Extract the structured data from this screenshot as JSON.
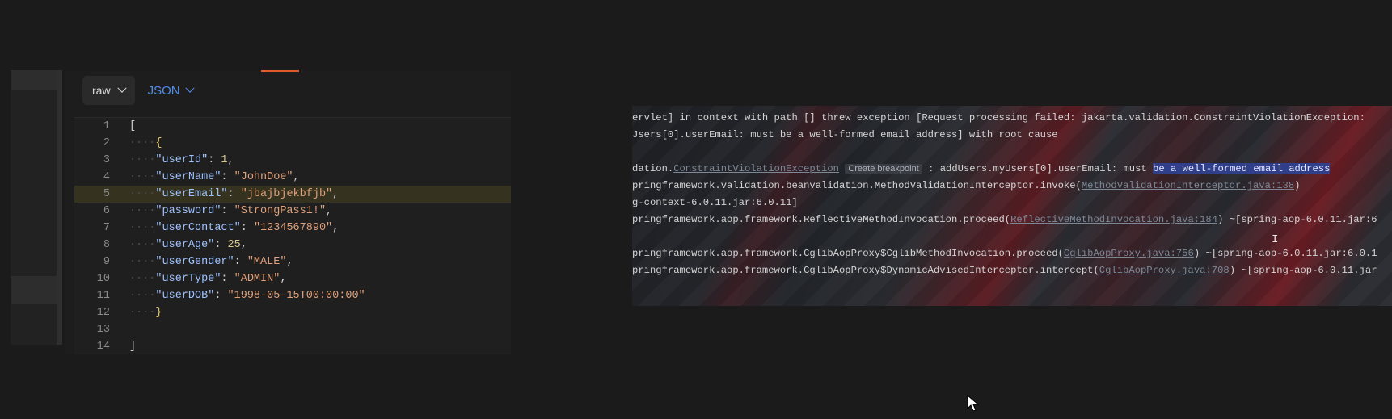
{
  "body_editor": {
    "format_dropdown": "raw",
    "type_dropdown": "JSON",
    "lines": [
      {
        "num": "1",
        "parts": [
          {
            "t": "p",
            "v": "["
          }
        ]
      },
      {
        "num": "2",
        "parts": [
          {
            "t": "d",
            "v": "····"
          },
          {
            "t": "b",
            "v": "{"
          }
        ]
      },
      {
        "num": "3",
        "parts": [
          {
            "t": "d",
            "v": "····"
          },
          {
            "t": "k",
            "v": "\"userId\""
          },
          {
            "t": "p",
            "v": ": "
          },
          {
            "t": "n",
            "v": "1"
          },
          {
            "t": "p",
            "v": ","
          }
        ]
      },
      {
        "num": "4",
        "parts": [
          {
            "t": "d",
            "v": "····"
          },
          {
            "t": "k",
            "v": "\"userName\""
          },
          {
            "t": "p",
            "v": ": "
          },
          {
            "t": "s",
            "v": "\"JohnDoe\""
          },
          {
            "t": "p",
            "v": ","
          }
        ]
      },
      {
        "num": "5",
        "highlight": true,
        "parts": [
          {
            "t": "d",
            "v": "····"
          },
          {
            "t": "k",
            "v": "\"userEmail\""
          },
          {
            "t": "p",
            "v": ": "
          },
          {
            "t": "s",
            "v": "\"jbajbjekbfjb\""
          },
          {
            "t": "p",
            "v": ","
          }
        ]
      },
      {
        "num": "6",
        "parts": [
          {
            "t": "d",
            "v": "····"
          },
          {
            "t": "k",
            "v": "\"password\""
          },
          {
            "t": "p",
            "v": ": "
          },
          {
            "t": "s",
            "v": "\"StrongPass1!\""
          },
          {
            "t": "p",
            "v": ","
          }
        ]
      },
      {
        "num": "7",
        "parts": [
          {
            "t": "d",
            "v": "····"
          },
          {
            "t": "k",
            "v": "\"userContact\""
          },
          {
            "t": "p",
            "v": ": "
          },
          {
            "t": "s",
            "v": "\"1234567890\""
          },
          {
            "t": "p",
            "v": ","
          }
        ]
      },
      {
        "num": "8",
        "parts": [
          {
            "t": "d",
            "v": "····"
          },
          {
            "t": "k",
            "v": "\"userAge\""
          },
          {
            "t": "p",
            "v": ": "
          },
          {
            "t": "n",
            "v": "25"
          },
          {
            "t": "p",
            "v": ","
          }
        ]
      },
      {
        "num": "9",
        "parts": [
          {
            "t": "d",
            "v": "····"
          },
          {
            "t": "k",
            "v": "\"userGender\""
          },
          {
            "t": "p",
            "v": ": "
          },
          {
            "t": "s",
            "v": "\"MALE\""
          },
          {
            "t": "p",
            "v": ","
          }
        ]
      },
      {
        "num": "10",
        "parts": [
          {
            "t": "d",
            "v": "····"
          },
          {
            "t": "k",
            "v": "\"userType\""
          },
          {
            "t": "p",
            "v": ": "
          },
          {
            "t": "s",
            "v": "\"ADMIN\""
          },
          {
            "t": "p",
            "v": ","
          }
        ]
      },
      {
        "num": "11",
        "parts": [
          {
            "t": "d",
            "v": "····"
          },
          {
            "t": "k",
            "v": "\"userDOB\""
          },
          {
            "t": "p",
            "v": ": "
          },
          {
            "t": "s",
            "v": "\"1998-05-15T00:00:00\""
          }
        ]
      },
      {
        "num": "12",
        "parts": [
          {
            "t": "d",
            "v": "····"
          },
          {
            "t": "b",
            "v": "}"
          }
        ]
      },
      {
        "num": "13",
        "parts": []
      },
      {
        "num": "14",
        "parts": [
          {
            "t": "p",
            "v": "]"
          }
        ]
      }
    ]
  },
  "console": {
    "line1": "ervlet] in context with path [] threw exception [Request processing failed: jakarta.validation.ConstraintViolationException: ",
    "line2": "Jsers[0].userEmail: must be a well-formed email address] with root cause",
    "line3_prefix": "dation.",
    "line3_link": "ConstraintViolationException",
    "line3_badge": "Create breakpoint",
    "line3_mid": " : addUsers.myUsers[0].userEmail: must ",
    "line3_selected": "be a well-formed email address",
    "line4_prefix": "pringframework.validation.beanvalidation.MethodValidationInterceptor.invoke(",
    "line4_link": "MethodValidationInterceptor.java:138",
    "line4_suffix": ")",
    "line5": "g-context-6.0.11.jar:6.0.11]",
    "line6_prefix": "pringframework.aop.framework.ReflectiveMethodInvocation.proceed(",
    "line6_link": "ReflectiveMethodInvocation.java:184",
    "line6_suffix": ") ~[spring-aop-6.0.11.jar:6",
    "line7_prefix": "pringframework.aop.framework.CglibAopProxy$CglibMethodInvocation.proceed(",
    "line7_link": "CglibAopProxy.java:756",
    "line7_suffix": ") ~[spring-aop-6.0.11.jar:6.0.1",
    "line8_prefix": "pringframework.aop.framework.CglibAopProxy$DynamicAdvisedInterceptor.intercept(",
    "line8_link": "CglibAopProxy.java:708",
    "line8_suffix": ") ~[spring-aop-6.0.11.jar"
  }
}
